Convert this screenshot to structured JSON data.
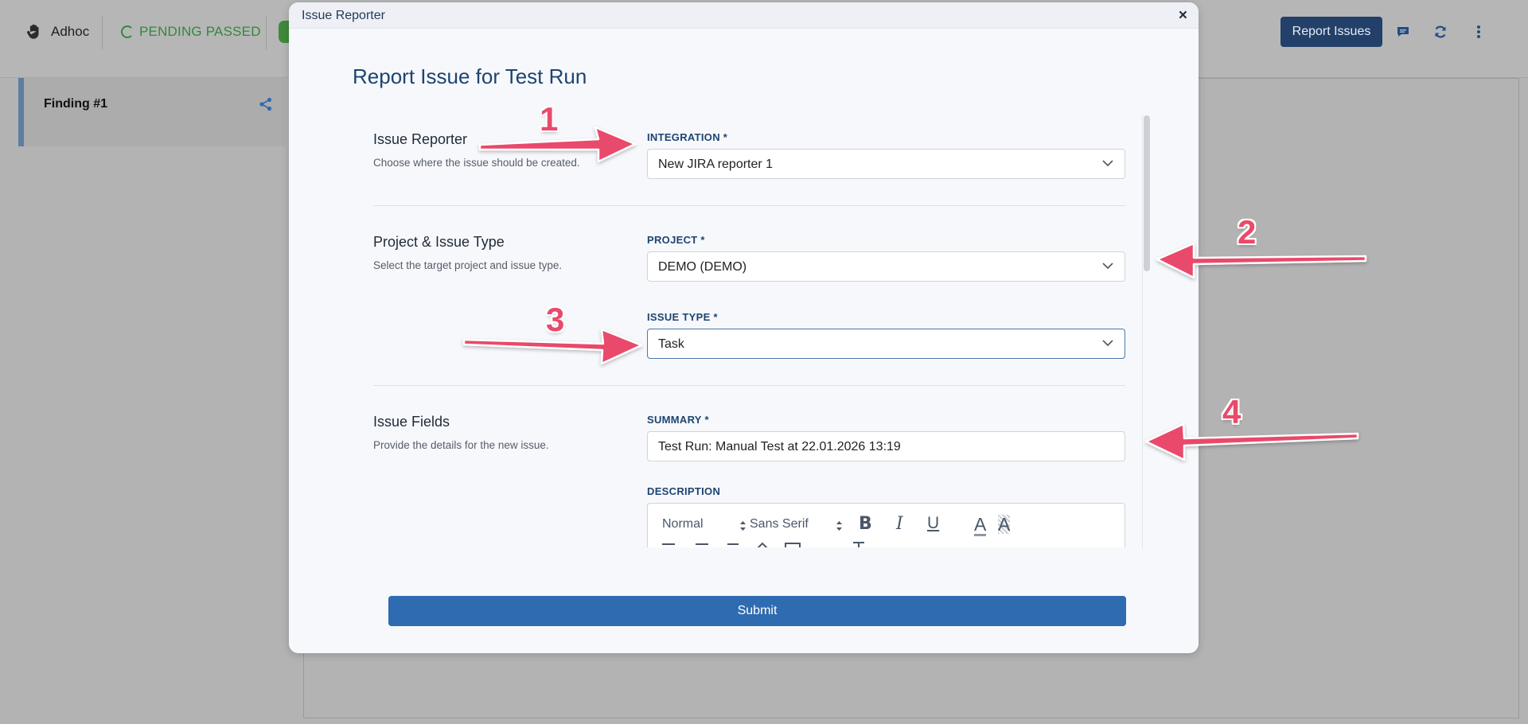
{
  "topbar": {
    "mode_label": "Adhoc",
    "status_label": "PENDING PASSED",
    "report_button": "Report Issues",
    "icons": [
      "hand-icon",
      "pending-ring-icon",
      "chat-icon",
      "refresh-icon",
      "more-vertical-icon"
    ]
  },
  "sidebar": {
    "finding_title": "Finding #1",
    "share_icon": "share-icon"
  },
  "modal": {
    "window_title": "Issue Reporter",
    "close_label": "×",
    "heading": "Report Issue for Test Run",
    "sections": {
      "reporter": {
        "title": "Issue Reporter",
        "description": "Choose where the issue should be created."
      },
      "project": {
        "title": "Project & Issue Type",
        "description": "Select the target project and issue type."
      },
      "fields": {
        "title": "Issue Fields",
        "description": "Provide the details for the new issue."
      }
    },
    "integration": {
      "label": "INTEGRATION *",
      "value": "New JIRA reporter 1"
    },
    "project": {
      "label": "PROJECT *",
      "value": "DEMO (DEMO)"
    },
    "issue_type": {
      "label": "ISSUE TYPE *",
      "value": "Task"
    },
    "summary": {
      "label": "SUMMARY *",
      "value": "Test Run: Manual Test at 22.01.2026 13:19"
    },
    "description": {
      "label": "DESCRIPTION",
      "toolbar": {
        "heading_select": "Normal",
        "font_select": "Sans Serif",
        "bold": "B",
        "italic": "I",
        "underline": "U",
        "text_color": "A",
        "highlight": "A"
      }
    },
    "submit_label": "Submit"
  },
  "annotations": {
    "n1": "1",
    "n2": "2",
    "n3": "3",
    "n4": "4",
    "arrow_color": "#e94a6b"
  },
  "colors": {
    "brand": "#2f6bb1",
    "heading": "#1d4470",
    "status_green": "#2f8a3a"
  }
}
